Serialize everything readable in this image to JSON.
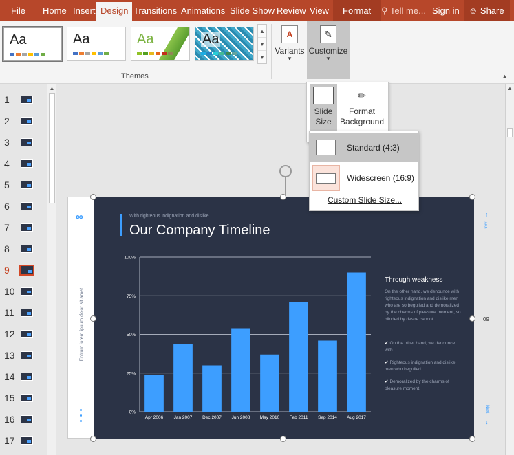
{
  "ribbon": {
    "tabs": [
      {
        "label": "File"
      },
      {
        "label": "Home"
      },
      {
        "label": "Insert"
      },
      {
        "label": "Design"
      },
      {
        "label": "Transitions"
      },
      {
        "label": "Animations"
      },
      {
        "label": "Slide Show"
      },
      {
        "label": "Review"
      },
      {
        "label": "View"
      },
      {
        "label": "Format"
      },
      {
        "label": "Tell me..."
      },
      {
        "label": "Sign in"
      },
      {
        "label": "Share"
      }
    ],
    "themes_label": "Themes",
    "theme_text": "Aa",
    "variants_label": "Variants",
    "customize_label": "Customize",
    "colors": {
      "accent": "#b7472a",
      "format_tab": "#a33c22"
    }
  },
  "customize_panel": {
    "slide_size_label": "Slide Size",
    "format_background_label": "Format Background"
  },
  "size_menu": {
    "standard": "Standard (4:3)",
    "widescreen": "Widescreen (16:9)",
    "custom": "Custom Slide Size..."
  },
  "thumbnails": {
    "numbers": [
      "1",
      "2",
      "3",
      "4",
      "5",
      "6",
      "7",
      "8",
      "9",
      "10",
      "11",
      "12",
      "13",
      "14",
      "15",
      "16",
      "17"
    ],
    "selected": "9"
  },
  "slide": {
    "subtitle": "With righteous indignation and dislike.",
    "title": "Our Company Timeline",
    "side_text": "Entrum lorem ipsum dolor sit amet",
    "right_heading": "Through weakness",
    "right_body": "On the other hand, we denounce with righteous indignation and dislike men who are so beguiled and demoralized by the charms of pleasure moment, so blinded by desire cannot.",
    "bullets": [
      "On the other hand, we denounce with.",
      "Righteous indignation and dislike men who beguiled.",
      "Demoralized by the charms of pleasure moment."
    ],
    "nav_prev": "Prev",
    "nav_next": "Next",
    "page_number": "09"
  },
  "chart_data": {
    "type": "bar",
    "categories": [
      "Apr 2006",
      "Jan 2007",
      "Dec 2007",
      "Jun 2008",
      "May 2010",
      "Feb 2011",
      "Sep 2014",
      "Aug 2017"
    ],
    "values": [
      24,
      44,
      30,
      54,
      37,
      71,
      46,
      90
    ],
    "yticks": [
      "0%",
      "25%",
      "50%",
      "75%",
      "100%"
    ],
    "ylim": [
      0,
      100
    ],
    "bar_color": "#3d9eff",
    "grid": true
  }
}
